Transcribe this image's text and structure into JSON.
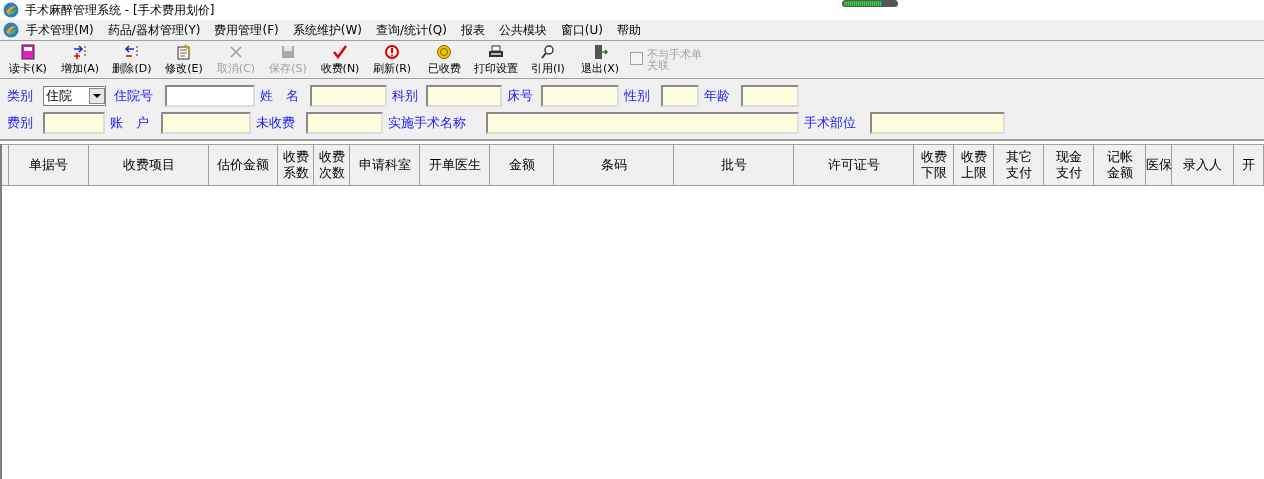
{
  "window": {
    "title": "手术麻醉管理系统 - [手术费用划价]"
  },
  "menu": [
    "手术管理(M)",
    "药品/器材管理(Y)",
    "费用管理(F)",
    "系统维护(W)",
    "查询/统计(Q)",
    "报表",
    "公共模块",
    "窗口(U)",
    "帮助"
  ],
  "toolbar": [
    {
      "label": "读卡(K)",
      "disabled": false
    },
    {
      "label": "增加(A)",
      "disabled": false
    },
    {
      "label": "删除(D)",
      "disabled": false
    },
    {
      "label": "修改(E)",
      "disabled": false
    },
    {
      "label": "取消(C)",
      "disabled": true
    },
    {
      "label": "保存(S)",
      "disabled": true
    },
    {
      "label": "收费(N)",
      "disabled": false
    },
    {
      "label": "刷新(R)",
      "disabled": false
    },
    {
      "label": "已收费",
      "disabled": false
    },
    {
      "label": "打印设置",
      "disabled": false
    },
    {
      "label": "引用(I)",
      "disabled": false
    },
    {
      "label": "退出(X)",
      "disabled": false
    }
  ],
  "link_checkbox": {
    "label": "不与手术单关联",
    "checked": false,
    "disabled": true
  },
  "form_rows": [
    [
      {
        "label": "类别",
        "kind": "select",
        "value": "住院"
      },
      {
        "label": "住院号",
        "kind": "input",
        "readonly": false
      },
      {
        "label": "姓　名",
        "kind": "input",
        "readonly": true
      },
      {
        "label": "科别",
        "kind": "input",
        "readonly": true
      },
      {
        "label": "床号",
        "kind": "input",
        "readonly": true
      },
      {
        "label": "性别",
        "kind": "input",
        "readonly": true
      },
      {
        "label": "年龄",
        "kind": "input",
        "readonly": true
      }
    ],
    [
      {
        "label": "费别",
        "kind": "input",
        "readonly": true
      },
      {
        "label": "账　户",
        "kind": "input",
        "readonly": true
      },
      {
        "label": "未收费",
        "kind": "input",
        "readonly": true
      },
      {
        "label": "实施手术名称",
        "kind": "input",
        "readonly": true
      },
      {
        "label": "手术部位",
        "kind": "input",
        "readonly": true
      }
    ]
  ],
  "table": {
    "columns": [
      "单据号",
      "收费项目",
      "估价金额",
      "收费系数",
      "收费次数",
      "申请科室",
      "开单医生",
      "金额",
      "条码",
      "批号",
      "许可证号",
      "收费下限",
      "收费上限",
      "其它支付",
      "现金支付",
      "记帐金额",
      "医保",
      "录入人",
      "开"
    ]
  }
}
